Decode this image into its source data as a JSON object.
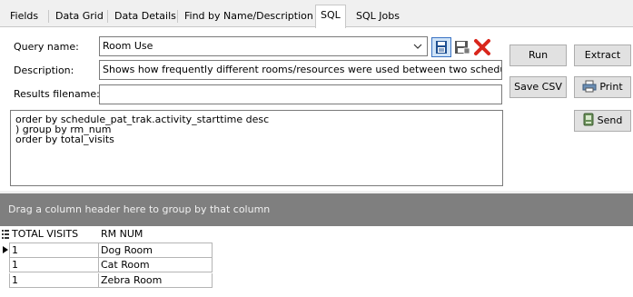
{
  "tabs": [
    "Fields",
    "Data Grid",
    "Data Details",
    "Find by Name/Description",
    "SQL",
    "SQL Jobs"
  ],
  "active_tab": "SQL",
  "form": {
    "query_name_label": "Query name:",
    "query_name_value": "Room Use",
    "description_label": "Description:",
    "description_value": "Shows how frequently different rooms/resources were used between two schedule",
    "results_filename_label": "Results filename:",
    "results_filename_value": ""
  },
  "buttons": {
    "run": "Run",
    "extract": "Extract",
    "save_csv": "Save CSV",
    "print": "Print",
    "send": "Send"
  },
  "sql_lines": [
    "order by schedule_pat_trak.activity_starttime desc",
    ") group by rm_num",
    "order by total_visits"
  ],
  "group_panel_text": "Drag a column header here to group by that column",
  "grid": {
    "columns": [
      "TOTAL VISITS",
      "RM NUM"
    ],
    "rows": [
      [
        "1",
        "Dog Room"
      ],
      [
        "1",
        "Cat Room"
      ],
      [
        "1",
        "Zebra Room"
      ]
    ]
  },
  "icons": {
    "save": "save-icon",
    "save_as": "save-as-icon",
    "delete": "delete-x-icon",
    "print": "printer-icon",
    "send": "send-phone-icon",
    "dropdown": "chevron-down-icon",
    "row_selector": "triangle-right-icon",
    "column_chooser": "column-list-icon"
  },
  "colors": {
    "delete_red": "#d9261c",
    "group_panel_bg": "#7f7f7f",
    "save_blue": "#1e4f91"
  }
}
